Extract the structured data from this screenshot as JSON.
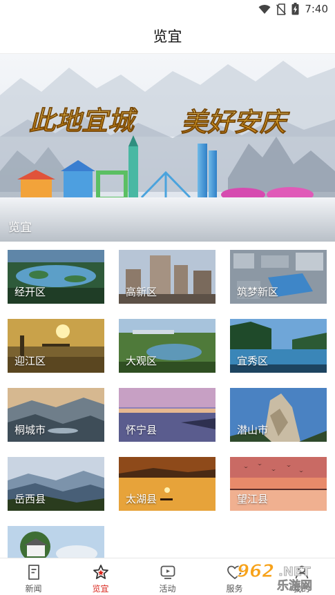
{
  "status_bar": {
    "time": "7:40",
    "icons": [
      "wifi-icon",
      "no-sim-icon",
      "battery-charging-icon"
    ]
  },
  "header": {
    "title": "览宜"
  },
  "banner": {
    "slogan_left": "此地宜城",
    "slogan_right": "美好安庆",
    "caption": "览宜"
  },
  "regions": [
    {
      "label": "经开区",
      "theme": "lake-park"
    },
    {
      "label": "高新区",
      "theme": "high-rise"
    },
    {
      "label": "筑梦新区",
      "theme": "aerial-city"
    },
    {
      "label": "迎江区",
      "theme": "sunset-river"
    },
    {
      "label": "大观区",
      "theme": "green-lake"
    },
    {
      "label": "宜秀区",
      "theme": "blue-lake"
    },
    {
      "label": "桐城市",
      "theme": "misty-mountain"
    },
    {
      "label": "怀宁县",
      "theme": "purple-dusk"
    },
    {
      "label": "潜山市",
      "theme": "rock-peak"
    },
    {
      "label": "岳西县",
      "theme": "mountain-ridges"
    },
    {
      "label": "太湖县",
      "theme": "golden-lake"
    },
    {
      "label": "望江县",
      "theme": "bird-sunset"
    },
    {
      "label": "",
      "theme": "temple-hill"
    }
  ],
  "tabbar": {
    "items": [
      {
        "label": "新闻",
        "icon": "news-icon"
      },
      {
        "label": "览宜",
        "icon": "star-icon"
      },
      {
        "label": "活动",
        "icon": "tv-icon"
      },
      {
        "label": "服务",
        "icon": "heart-icon"
      },
      {
        "label": "我的",
        "icon": "user-icon"
      }
    ]
  },
  "watermark": {
    "number": "962",
    "suffix": ".NET",
    "sub": "乐游网"
  },
  "colors": {
    "accent": "#d9251c",
    "tab_text": "#555555"
  }
}
